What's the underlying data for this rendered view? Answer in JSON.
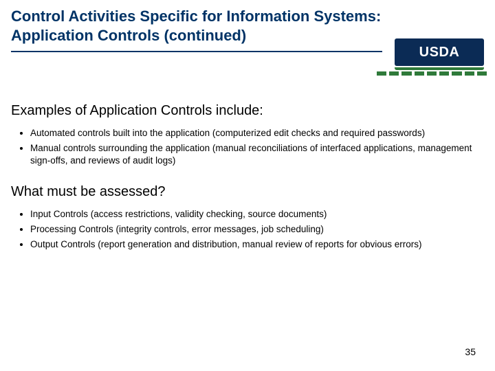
{
  "title_line1": "Control Activities Specific for Information Systems:",
  "title_line2": "Application Controls (continued)",
  "logo_text": "USDA",
  "section1_heading": "Examples of Application Controls include:",
  "section1_bullets": [
    "Automated controls built into the application (computerized edit checks and required passwords)",
    "Manual controls surrounding the application (manual reconciliations of interfaced applications, management sign-offs, and reviews of audit logs)"
  ],
  "section2_heading": "What must be assessed?",
  "section2_bullets": [
    "Input Controls (access restrictions, validity checking, source documents)",
    "Processing Controls (integrity controls, error messages, job scheduling)",
    "Output Controls (report generation and distribution, manual review of reports for obvious errors)"
  ],
  "page_number": "35"
}
